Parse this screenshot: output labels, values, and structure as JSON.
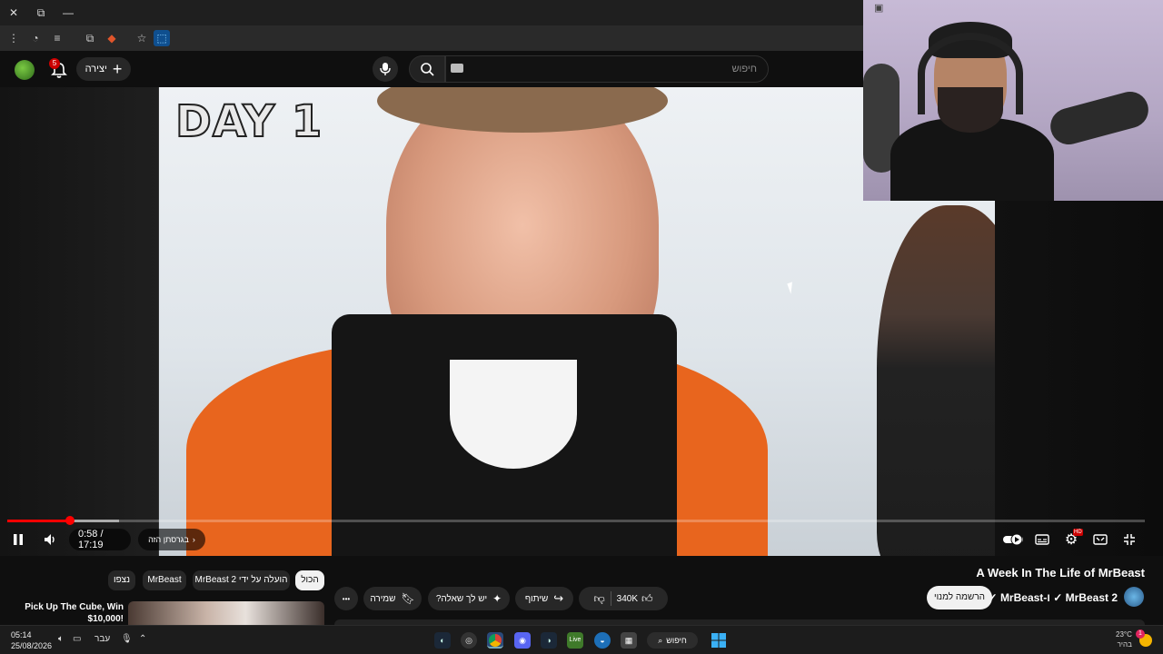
{
  "browser": {
    "window_controls": {
      "close": "✕",
      "restore": "⧉",
      "minimize": "—"
    },
    "toolbar_icons": [
      "more-vert-icon",
      "sync-icon",
      "reading-list-icon",
      "extensions-icon",
      "ublock-icon",
      "star-icon",
      "active-extension-icon"
    ]
  },
  "youtube": {
    "header": {
      "notifications_count": "5",
      "create_label": "יצירה",
      "search_placeholder": "חיפוש"
    },
    "player": {
      "overlay_title": "DAY 1",
      "current_time": "0:58",
      "duration": "17:19",
      "time_display": "0:58 / 17:19",
      "version_label": "בגרסתן הזה",
      "progress_played": 0.055,
      "progress_buffered": 0.098,
      "settings_badge": "HD"
    },
    "video": {
      "title": "A Week In The Life of MrBeast",
      "channel": "MrBeast 2 ✓ ו-MrBeast ✓",
      "subscribe_label": "הרשמה למנוי",
      "likes": "340K",
      "share_label": "שיתוף",
      "ask_label": "יש לך שאלה?",
      "save_label": "שמירה",
      "more_label": "•••"
    },
    "filter_chips": [
      {
        "label": "הכול",
        "selected": true
      },
      {
        "label": "הועלה על ידי MrBeast 2",
        "selected": false
      },
      {
        "label": "MrBeast",
        "selected": false
      },
      {
        "label": "נצפו",
        "selected": false
      }
    ],
    "recommendation": {
      "title": "Pick Up The Cube, Win $10,000!"
    }
  },
  "taskbar": {
    "time": "05:14",
    "date": "25/08/2026",
    "language": "עבר",
    "search_label": "חיפוש",
    "weather_temp": "23°C",
    "weather_desc": "בהיר",
    "notification_count": "1",
    "apps": [
      "steam-icon",
      "obs-icon",
      "chrome-icon",
      "discord-icon",
      "steam-alt-icon",
      "live-icon",
      "edge-icon",
      "calculator-icon"
    ]
  },
  "colors": {
    "progress_played": "#ff0000",
    "background": "#0f0f0f",
    "chip_selected": "#f1f1f1"
  }
}
